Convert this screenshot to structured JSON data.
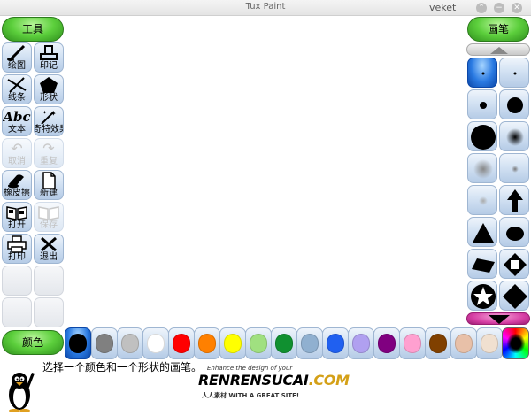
{
  "window": {
    "title": "Tux Paint",
    "user": "veket",
    "controls": [
      "⌃",
      "−",
      "✕"
    ]
  },
  "tools_header": "工具",
  "brushes_header": "画笔",
  "colors_header": "颜色",
  "tools": [
    {
      "label": "绘图",
      "icon": "paintbrush-icon",
      "state": "selected"
    },
    {
      "label": "印记",
      "icon": "stamp-icon",
      "state": "normal"
    },
    {
      "label": "线条",
      "icon": "lines-icon",
      "state": "normal"
    },
    {
      "label": "形状",
      "icon": "pentagon-icon",
      "state": "normal"
    },
    {
      "label": "文本",
      "icon": "text-icon",
      "state": "normal",
      "glyph": "Abc"
    },
    {
      "label": "奇特效果",
      "icon": "magic-wand-icon",
      "state": "normal"
    },
    {
      "label": "取消",
      "icon": "undo-icon",
      "state": "disabled"
    },
    {
      "label": "重复",
      "icon": "redo-icon",
      "state": "disabled"
    },
    {
      "label": "橡皮擦",
      "icon": "eraser-icon",
      "state": "normal"
    },
    {
      "label": "新建",
      "icon": "new-page-icon",
      "state": "normal"
    },
    {
      "label": "打开",
      "icon": "open-book-icon",
      "state": "normal"
    },
    {
      "label": "保存",
      "icon": "save-icon",
      "state": "disabled"
    },
    {
      "label": "打印",
      "icon": "printer-icon",
      "state": "normal"
    },
    {
      "label": "退出",
      "icon": "exit-icon",
      "state": "normal"
    }
  ],
  "brushes": [
    {
      "name": "brush-dot-tiny",
      "selected": true
    },
    {
      "name": "brush-dot-tiny-2",
      "selected": false
    },
    {
      "name": "brush-dot-small",
      "selected": false
    },
    {
      "name": "brush-dot-medium",
      "selected": false
    },
    {
      "name": "brush-dot-large",
      "selected": false
    },
    {
      "name": "brush-fuzzy-medium",
      "selected": false
    },
    {
      "name": "brush-fuzzy-gray",
      "selected": false
    },
    {
      "name": "brush-fuzzy-small",
      "selected": false
    },
    {
      "name": "brush-fuzzy-faint",
      "selected": false
    },
    {
      "name": "brush-arrow-up",
      "selected": false
    },
    {
      "name": "brush-triangle",
      "selected": false
    },
    {
      "name": "brush-blob",
      "selected": false
    },
    {
      "name": "brush-parallelogram",
      "selected": false
    },
    {
      "name": "brush-diamond-outline",
      "selected": false
    },
    {
      "name": "brush-star",
      "selected": false
    },
    {
      "name": "brush-diamond",
      "selected": false
    }
  ],
  "colors": [
    {
      "hex": "#000000",
      "selected": true
    },
    {
      "hex": "#808080",
      "selected": false
    },
    {
      "hex": "#c0c0c0",
      "selected": false
    },
    {
      "hex": "#ffffff",
      "selected": false
    },
    {
      "hex": "#ff0000",
      "selected": false
    },
    {
      "hex": "#ff8000",
      "selected": false
    },
    {
      "hex": "#ffff00",
      "selected": false
    },
    {
      "hex": "#a0e080",
      "selected": false
    },
    {
      "hex": "#109030",
      "selected": false
    },
    {
      "hex": "#90b0d0",
      "selected": false
    },
    {
      "hex": "#2060f0",
      "selected": false
    },
    {
      "hex": "#b0a0f0",
      "selected": false
    },
    {
      "hex": "#800080",
      "selected": false
    },
    {
      "hex": "#ffa0d0",
      "selected": false
    },
    {
      "hex": "#804000",
      "selected": false
    },
    {
      "hex": "#e8c0a8",
      "selected": false
    },
    {
      "hex": "#f0e0d0",
      "selected": false
    }
  ],
  "message": "选择一个颜色和一个形状的画笔。",
  "watermark": {
    "tagline": "Enhance the design of your",
    "brand_a": "RENRENSUCAI",
    "brand_b": ".COM",
    "sub": "人人素材  WITH A GREAT SITE!"
  }
}
